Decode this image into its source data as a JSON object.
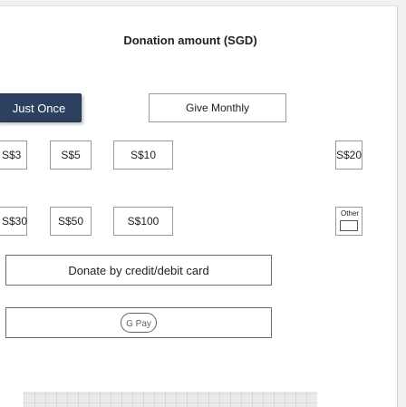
{
  "form": {
    "heading": "Donation amount (SGD)",
    "frequency": {
      "once_label": "Just Once",
      "monthly_label": "Give Monthly",
      "selected": "Just Once"
    },
    "amounts": [
      "S$3",
      "S$5",
      "S$10",
      "S$20",
      "S$30",
      "S$50",
      "S$100"
    ],
    "other_label": "Other",
    "other_value": "",
    "card_button_label": "Donate by credit/debit card",
    "gpay_button": {
      "icon": "google-pay-icon",
      "label": "G Pay"
    }
  },
  "colors": {
    "selected_fill": "#2c4060",
    "border": "#9a9a9a",
    "background": "#ffffff"
  }
}
